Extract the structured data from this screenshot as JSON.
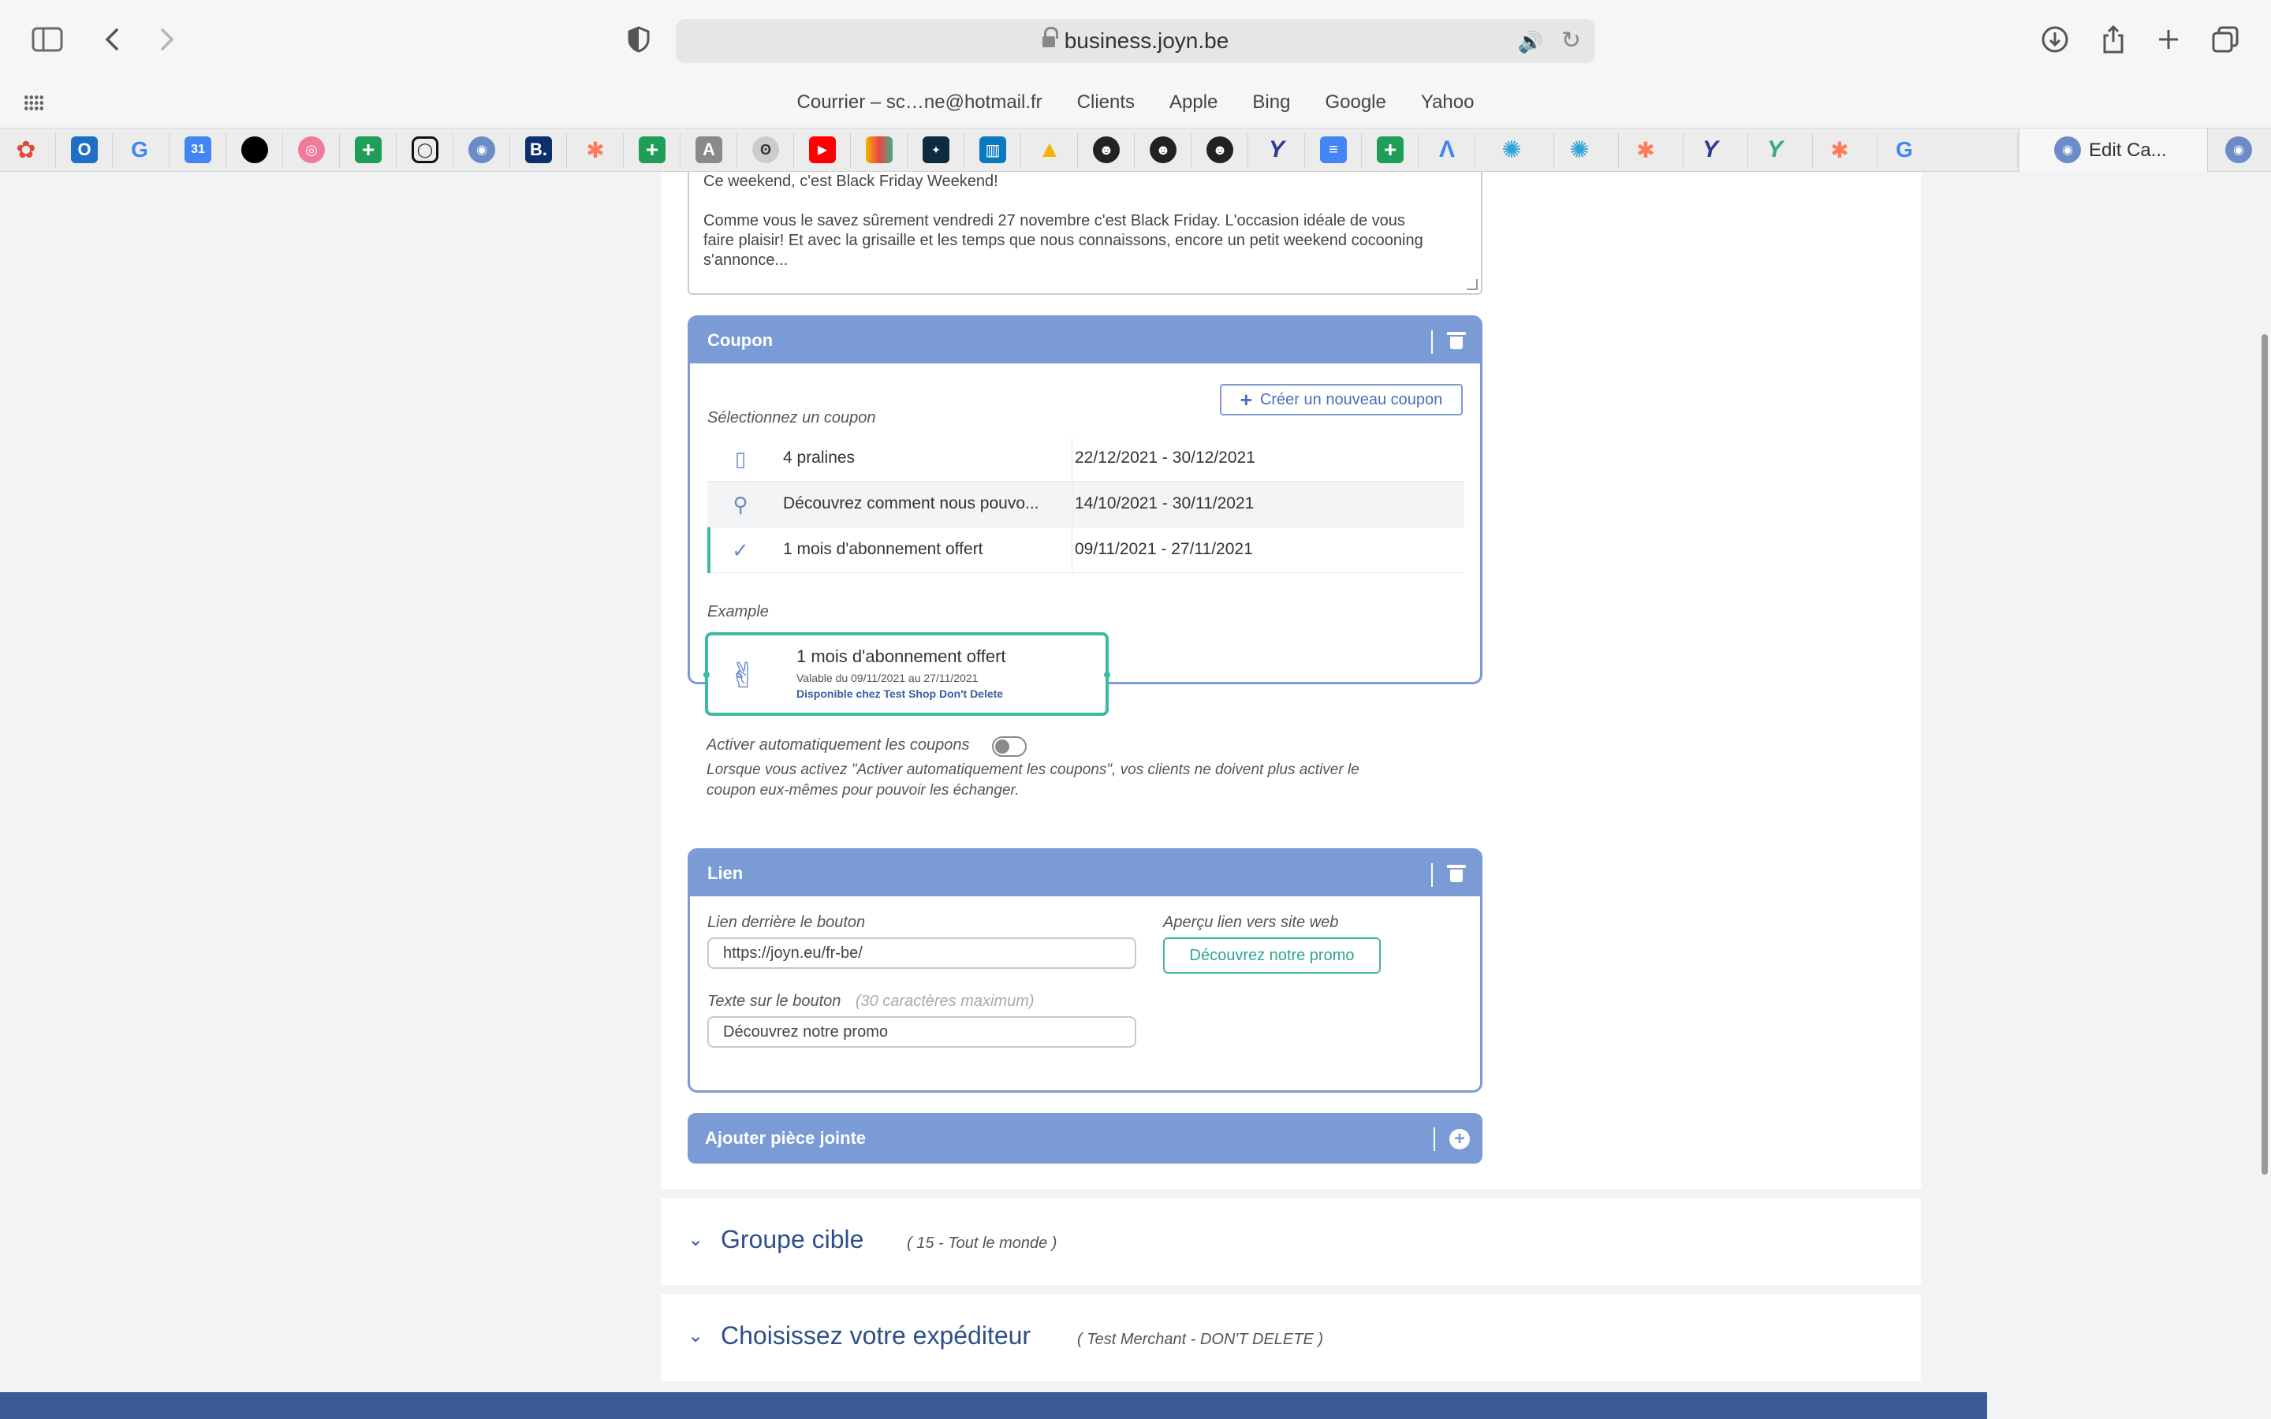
{
  "browser": {
    "url": "business.joyn.be",
    "favorites": [
      "Courrier – sc…ne@hotmail.fr",
      "Clients",
      "Apple",
      "Bing",
      "Google",
      "Yahoo"
    ],
    "active_tab_title": "Edit Ca..."
  },
  "message": {
    "line1": "Ce weekend, c'est Black Friday Weekend!",
    "line2": "Comme vous le savez sûrement vendredi 27 novembre c'est Black Friday. L'occasion idéale de vous",
    "line3": "faire plaisir! Et avec la grisaille et les temps que nous connaissons, encore un petit weekend cocooning",
    "line4": "s'annonce..."
  },
  "coupon": {
    "header": "Coupon",
    "new_button": "Créer un nouveau coupon",
    "select_label": "Sélectionnez un coupon",
    "rows": [
      {
        "icon": "box-icon",
        "name": "4 pralines",
        "dates": "22/12/2021 - 30/12/2021"
      },
      {
        "icon": "balloons-icon",
        "name": "Découvrez comment nous pouvo...",
        "dates": "14/10/2021 - 30/11/2021"
      },
      {
        "icon": "thumbs-up-icon",
        "name": "1 mois d'abonnement offert",
        "dates": "09/11/2021 - 27/11/2021"
      }
    ],
    "example_label": "Example",
    "example": {
      "title": "1 mois d'abonnement offert",
      "valid": "Valable du 09/11/2021 au 27/11/2021",
      "available": "Disponible chez  Test Shop Don't Delete"
    },
    "auto_activate_label": "Activer automatiquement les coupons",
    "auto_activate_on": false,
    "auto_activate_help1": "Lorsque vous activez \"Activer automatiquement les coupons\", vos clients ne doivent plus activer le",
    "auto_activate_help2": "coupon eux-mêmes pour pouvoir les échanger."
  },
  "link": {
    "header": "Lien",
    "url_label": "Lien derrière le bouton",
    "url_value": "https://joyn.eu/fr-be/",
    "preview_label": "Aperçu lien vers site web",
    "preview_button": "Découvrez notre promo",
    "button_text_label": "Texte sur le bouton",
    "button_text_hint": "(30 caractères maximum)",
    "button_text_value": "Découvrez notre promo"
  },
  "attachment": {
    "header": "Ajouter pièce jointe"
  },
  "target_group": {
    "title": "Groupe cible",
    "meta": "( 15  -  Tout le monde )"
  },
  "sender": {
    "title": "Choisissez votre expéditeur",
    "meta": "( Test Merchant - DON'T DELETE )"
  },
  "colors": {
    "accent": "#7a9bd6",
    "selected": "#3dbaa2",
    "title": "#2f4f8a"
  }
}
